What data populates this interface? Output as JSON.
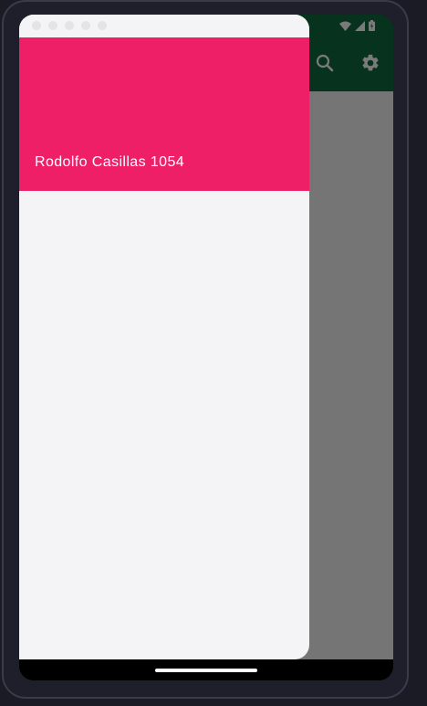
{
  "drawer": {
    "header_title": "Rodolfo Casillas 1054",
    "header_color": "#ee1f67",
    "background_color": "#f4f3f6"
  },
  "app_bar": {
    "color": "#0f6b3f",
    "actions": [
      {
        "icon": "search-icon"
      },
      {
        "icon": "gear-icon"
      }
    ]
  },
  "status_bar": {
    "icons": [
      "wifi-icon",
      "signal-icon",
      "battery-icon"
    ]
  }
}
